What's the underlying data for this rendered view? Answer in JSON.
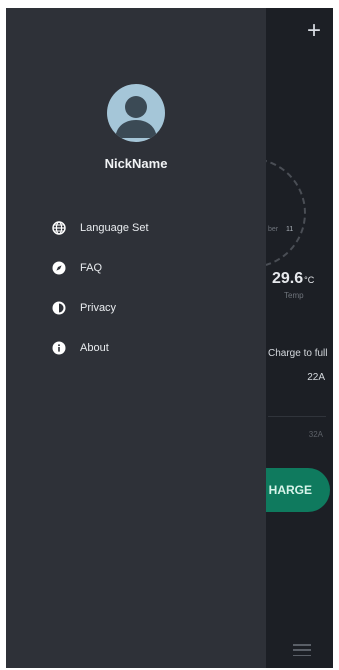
{
  "drawer": {
    "user": {
      "name": "NickName"
    },
    "items": [
      {
        "label": "Language Set",
        "icon": "globe-icon"
      },
      {
        "label": "FAQ",
        "icon": "compass-icon"
      },
      {
        "label": "Privacy",
        "icon": "privacy-icon"
      },
      {
        "label": "About",
        "icon": "info-icon"
      }
    ]
  },
  "background": {
    "add_icon": "+",
    "temperature": {
      "value": "29.6",
      "unit": "°C",
      "label": "Temp"
    },
    "gauge": {
      "label": "ber",
      "value": "11"
    },
    "charge_to_full": {
      "label": "Charge to full",
      "value": "22A"
    },
    "max_amps": "32A",
    "charge_button_label": "HARGE"
  },
  "colors": {
    "drawer_bg": "#2e3138",
    "app_bg": "#1c1f25",
    "accent": "#0f7a5e",
    "avatar_bg": "#a5c6d8"
  }
}
